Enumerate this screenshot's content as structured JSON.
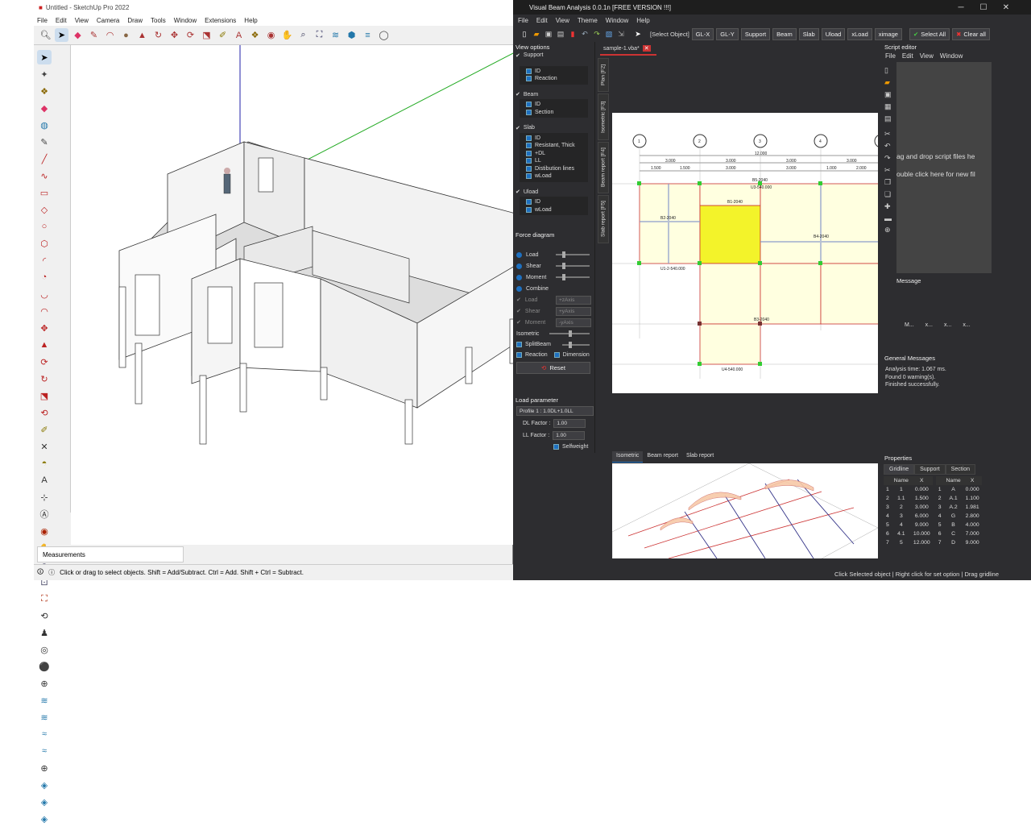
{
  "sketchup": {
    "title": "Untitled - SketchUp Pro 2022",
    "menu": [
      "File",
      "Edit",
      "View",
      "Camera",
      "Draw",
      "Tools",
      "Window",
      "Extensions",
      "Help"
    ],
    "measurements_label": "Measurements",
    "status_text": "Click or drag to select objects. Shift = Add/Subtract. Ctrl = Add. Shift + Ctrl = Subtract."
  },
  "vba": {
    "title": "Visual Beam Analysis 0.0.1n [FREE VERSION !!!]",
    "menu": [
      "File",
      "Edit",
      "View",
      "Theme",
      "Window",
      "Help"
    ],
    "toolbar": {
      "select_object": "[Select Object]",
      "buttons": [
        "GL-X",
        "GL-Y",
        "Support",
        "Beam",
        "Slab",
        "Uload",
        "xLoad",
        "ximage"
      ],
      "select_all": "Select All",
      "clear_all": "Clear all"
    },
    "view_options": {
      "title": "View options",
      "groups": [
        {
          "name": "Support",
          "items": [
            "ID",
            "Reaction"
          ]
        },
        {
          "name": "Beam",
          "items": [
            "ID",
            "Section"
          ]
        },
        {
          "name": "Slab",
          "items": [
            "ID",
            "Resistant, Thick",
            "+DL",
            "LL",
            "Distibution lines",
            "wLoad"
          ]
        },
        {
          "name": "Uload",
          "items": [
            "ID",
            "wLoad"
          ]
        }
      ]
    },
    "force_diagram": {
      "title": "Force diagram",
      "items": [
        "Load",
        "Shear",
        "Moment",
        "Combine"
      ],
      "axis_rows": [
        {
          "label": "Load",
          "axis": "+zAxis"
        },
        {
          "label": "Shear",
          "axis": "+yAxis"
        },
        {
          "label": "Moment",
          "axis": "-yAxis"
        }
      ],
      "isometric": "Isometric",
      "split_beam": "SplitBeam",
      "reaction": "Reaction",
      "dimension": "Dimension",
      "reset": "Reset"
    },
    "load_parameter": {
      "title": "Load parameter",
      "profile": "Profile 1 : 1.0DL+1.0LL",
      "dl_label": "DL Factor :",
      "dl_value": "1.00",
      "ll_label": "LL Factor :",
      "ll_value": "1.00",
      "selfweight": "Selfweight"
    },
    "doc_tab": "sample-1.vba*",
    "side_tabs": [
      "Plan [F2]",
      "Isometric [F3]",
      "Beam report [F4]",
      "Slab report [F5]"
    ],
    "bottom_tabs": [
      "Isometric",
      "Beam report",
      "Slab report"
    ],
    "script_editor": {
      "title": "Script editor",
      "menu": [
        "File",
        "Edit",
        "View",
        "Window"
      ],
      "hint1": "ag and drop script files he",
      "hint2": "ouble click here for new fil"
    },
    "message": {
      "title": "Message",
      "cols": [
        "M...",
        "x...",
        "x...",
        "x..."
      ]
    },
    "general_messages": {
      "title": "General Messages",
      "lines": [
        "Analysis time: 1.067 ms.",
        "Found 0 warning(s).",
        "Finished successfully."
      ]
    },
    "properties": {
      "title": "Properties",
      "tabs": [
        "Gridline",
        "Support",
        "Section"
      ],
      "headers": [
        "Name",
        "X"
      ],
      "left": [
        [
          "1",
          "1",
          "0.000"
        ],
        [
          "2",
          "1.1",
          "1.500"
        ],
        [
          "3",
          "2",
          "3.000"
        ],
        [
          "4",
          "3",
          "6.000"
        ],
        [
          "5",
          "4",
          "9.000"
        ],
        [
          "6",
          "4.1",
          "10.000"
        ],
        [
          "7",
          "5",
          "12.000"
        ]
      ],
      "right": [
        [
          "1",
          "A",
          "0.000"
        ],
        [
          "2",
          "A.1",
          "1.100"
        ],
        [
          "3",
          "A.2",
          "1.981"
        ],
        [
          "4",
          "G",
          "2.800"
        ],
        [
          "5",
          "B",
          "4.000"
        ],
        [
          "6",
          "C",
          "7.000"
        ],
        [
          "7",
          "D",
          "9.000"
        ]
      ]
    },
    "plan": {
      "grid_labels": [
        "1",
        "2",
        "3",
        "4"
      ],
      "dims_top": [
        "12.000",
        "3.000",
        "3.000",
        "3.000",
        "3.000",
        "1.500",
        "1.500",
        "3.000",
        "3.000",
        "1.000",
        "2.000"
      ],
      "beam_labels": [
        "B1-2040",
        "B2-2040",
        "B3-2040",
        "B4-2040",
        "B5-2040",
        "U1-2-540.000",
        "U3-540.000",
        "U4-540.000"
      ]
    },
    "status": "Click Selected object | Right click for set option | Drag gridline"
  }
}
